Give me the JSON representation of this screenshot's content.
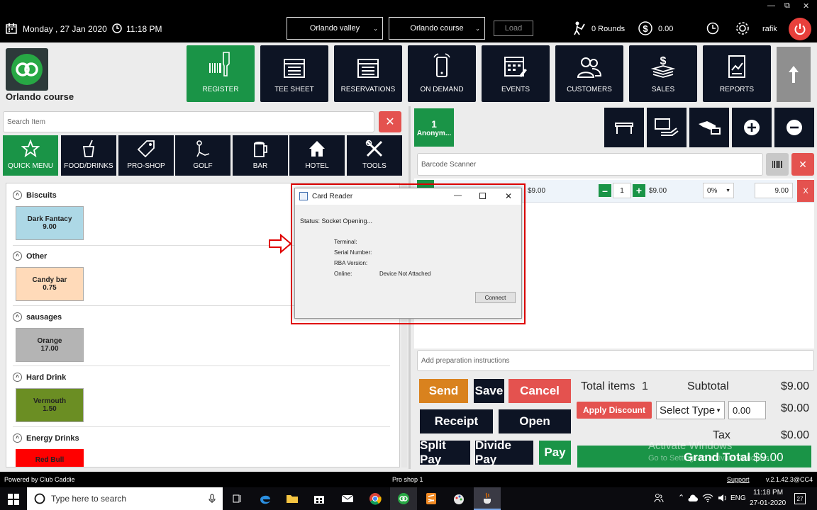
{
  "header": {
    "date": "Monday ,  27 Jan 2020",
    "time": "11:18 PM",
    "facility": "Orlando valley",
    "course": "Orlando course",
    "load_label": "Load",
    "rounds": "0 Rounds",
    "balance": "0.00",
    "user": "rafik"
  },
  "brand": {
    "name": "Orlando course"
  },
  "nav": [
    {
      "label": "REGISTER"
    },
    {
      "label": "TEE SHEET"
    },
    {
      "label": "RESERVATIONS"
    },
    {
      "label": "ON DEMAND"
    },
    {
      "label": "EVENTS"
    },
    {
      "label": "CUSTOMERS"
    },
    {
      "label": "SALES"
    },
    {
      "label": "REPORTS"
    }
  ],
  "search": {
    "placeholder": "Search Item"
  },
  "categories": [
    {
      "label": "QUICK MENU"
    },
    {
      "label": "FOOD/DRINKS"
    },
    {
      "label": "PRO-SHOP"
    },
    {
      "label": "GOLF"
    },
    {
      "label": "BAR"
    },
    {
      "label": "HOTEL"
    },
    {
      "label": "TOOLS"
    }
  ],
  "menu": [
    {
      "section": "Biscuits",
      "item": "Dark Fantacy",
      "price": "9.00",
      "color": "#add8e6"
    },
    {
      "section": "Other",
      "item": "Candy bar",
      "price": "0.75",
      "color": "#ffdab9"
    },
    {
      "section": "sausages",
      "item": "Orange",
      "price": "17.00",
      "color": "#b4b4b4"
    },
    {
      "section": "Hard Drink",
      "item": "Vermouth",
      "price": "1.50",
      "color": "#6b8e23"
    },
    {
      "section": "Energy Drinks",
      "item": "Red Bull",
      "price": "",
      "color": "#ff0000"
    }
  ],
  "customer_tab": {
    "count": "1",
    "name": "Anonym..."
  },
  "barcode": {
    "placeholder": "Barcode Scanner"
  },
  "cart_line": {
    "unit_price": "$9.00",
    "qty": "1",
    "line_price": "$9.00",
    "discount": "0%",
    "total": "9.00",
    "remove": "X"
  },
  "prep": {
    "placeholder": "Add preparation instructions"
  },
  "actions": {
    "send": "Send",
    "save": "Save",
    "cancel": "Cancel",
    "receipt": "Receipt",
    "open": "Open",
    "split_pay": "Split Pay",
    "divide_pay": "Divide Pay",
    "pay": "Pay"
  },
  "totals": {
    "items_label": "Total items",
    "items_count": "1",
    "subtotal_label": "Subtotal",
    "subtotal": "$9.00",
    "apply_discount": "Apply Discount",
    "select_type": "Select Type",
    "discount_input": "0.00",
    "discount_value": "$0.00",
    "tax_label": "Tax",
    "tax": "$0.00",
    "grand_label": "Grand Total",
    "grand_total": "$9.00"
  },
  "watermark": {
    "line1": "Activate Windows",
    "line2": "Go to Settings to activate Windows."
  },
  "dialog": {
    "title": "Card Reader",
    "status": "Status: Socket Opening...",
    "terminal": "Terminal:",
    "serial": "Serial Number:",
    "rba": "RBA Version:",
    "online": "Online:",
    "online_value": "Device Not Attached",
    "connect": "Connect"
  },
  "footer": {
    "powered": "Powered by Club Caddie",
    "shop": "Pro shop 1",
    "support": "Support",
    "version": "v.2.1.42.3@CC4"
  },
  "taskbar": {
    "search_placeholder": "Type here to search",
    "time": "11:18 PM",
    "date": "27-01-2020",
    "lang": "ENG",
    "notif": "27"
  },
  "colors": {
    "accent_green": "#1a9447",
    "navy": "#0d1424",
    "red": "#e4524f",
    "orange": "#d9821e",
    "highlight": "#e00000"
  }
}
